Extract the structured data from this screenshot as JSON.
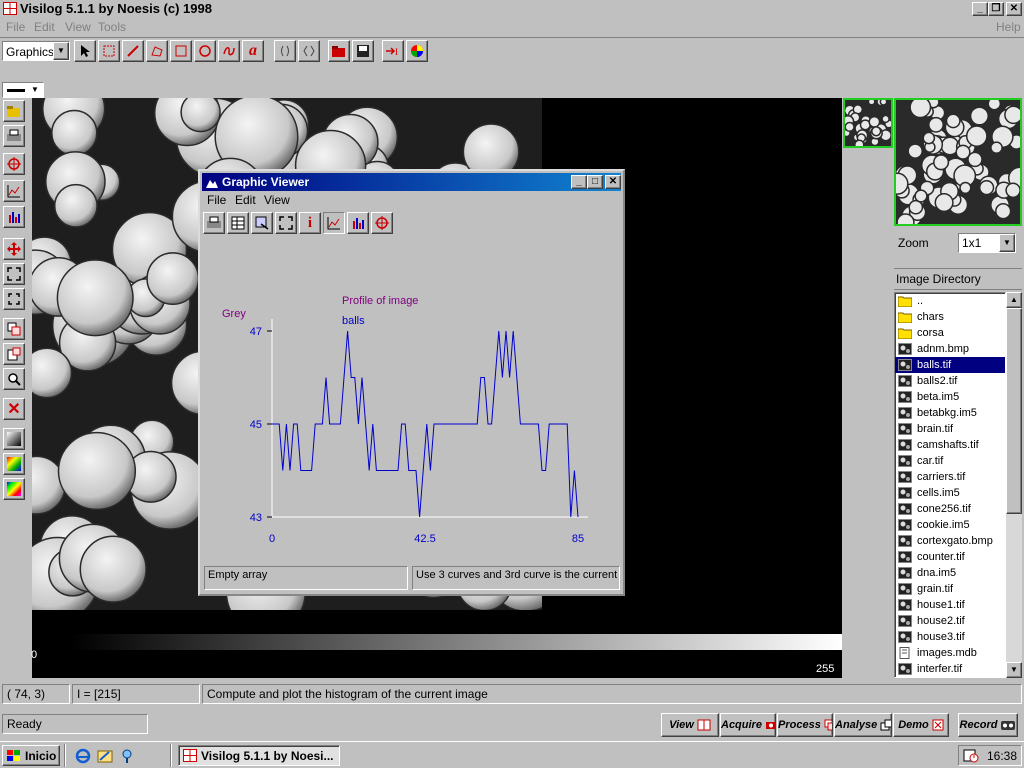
{
  "app": {
    "title": "Visilog 5.1.1 by Noesis (c) 1998"
  },
  "menu": {
    "items": [
      "File",
      "Edit",
      "View",
      "Tools"
    ],
    "help": "Help"
  },
  "toolbar": {
    "mode_select": "Graphics",
    "text_tool": "a"
  },
  "viewer": {
    "title": "Graphic Viewer",
    "menu": [
      "File",
      "Edit",
      "View"
    ],
    "info_icon": "i",
    "status_left": "Empty array",
    "status_right": "Use 3 curves and 3rd curve is the current"
  },
  "chart_data": {
    "type": "line",
    "title": "Profile of image",
    "series": [
      {
        "name": "balls",
        "x": [
          0,
          1,
          2,
          3,
          4,
          5,
          6,
          7,
          8,
          9,
          10,
          11,
          12,
          13,
          14,
          15,
          16,
          17,
          18,
          19,
          20,
          21,
          22,
          23,
          24,
          25,
          26,
          27,
          28,
          29,
          30,
          31,
          32,
          33,
          34,
          35,
          36,
          37,
          38,
          39,
          40,
          41,
          42,
          43,
          44,
          45,
          46,
          47,
          48,
          49,
          50,
          51,
          52,
          53,
          54,
          55,
          56,
          57,
          58,
          59,
          60,
          61,
          62,
          63,
          64,
          65,
          66,
          67,
          68,
          69,
          70,
          71,
          72,
          73,
          74,
          75,
          76,
          77,
          78,
          79,
          80,
          81,
          82,
          83,
          84,
          85
        ],
        "values": [
          45,
          45,
          45,
          44,
          45,
          44,
          45,
          45,
          44,
          44,
          44,
          44,
          45,
          45,
          45,
          46,
          45,
          45,
          45,
          45,
          46,
          47,
          46,
          46,
          45,
          46,
          45,
          44,
          45,
          44,
          44,
          44,
          44,
          44,
          44,
          44,
          45,
          45,
          44,
          44,
          44,
          43,
          44,
          45,
          44,
          45,
          45,
          45,
          45,
          45,
          45,
          45,
          45,
          45,
          45,
          45,
          45,
          45,
          46,
          46,
          45,
          45,
          46,
          47,
          46,
          47,
          46,
          47,
          46,
          45,
          45,
          45,
          45,
          45,
          45,
          44,
          44,
          45,
          45,
          45,
          45,
          45,
          45,
          43,
          44,
          43
        ]
      }
    ],
    "ylabel": "Grey",
    "ylim": [
      43,
      47
    ],
    "yticks": [
      "43",
      "45",
      "47"
    ],
    "xlim": [
      0,
      85
    ],
    "xticks": [
      "0",
      "42.5",
      "85"
    ]
  },
  "panel": {
    "zoom_label": "Zoom",
    "zoom_value": "1x1",
    "directory_label": "Image Directory",
    "files": [
      {
        "name": "..",
        "type": "folder"
      },
      {
        "name": "chars",
        "type": "folder"
      },
      {
        "name": "corsa",
        "type": "folder"
      },
      {
        "name": "adnm.bmp",
        "type": "image"
      },
      {
        "name": "balls.tif",
        "type": "image",
        "selected": true
      },
      {
        "name": "balls2.tif",
        "type": "image"
      },
      {
        "name": "beta.im5",
        "type": "image"
      },
      {
        "name": "betabkg.im5",
        "type": "image"
      },
      {
        "name": "brain.tif",
        "type": "image"
      },
      {
        "name": "camshafts.tif",
        "type": "image"
      },
      {
        "name": "car.tif",
        "type": "image"
      },
      {
        "name": "carriers.tif",
        "type": "image"
      },
      {
        "name": "cells.im5",
        "type": "image"
      },
      {
        "name": "cone256.tif",
        "type": "image"
      },
      {
        "name": "cookie.im5",
        "type": "image"
      },
      {
        "name": "cortexgato.bmp",
        "type": "image"
      },
      {
        "name": "counter.tif",
        "type": "image"
      },
      {
        "name": "dna.im5",
        "type": "image"
      },
      {
        "name": "grain.tif",
        "type": "image"
      },
      {
        "name": "house1.tif",
        "type": "image"
      },
      {
        "name": "house2.tif",
        "type": "image"
      },
      {
        "name": "house3.tif",
        "type": "image"
      },
      {
        "name": "images.mdb",
        "type": "doc"
      },
      {
        "name": "interfer.tif",
        "type": "image"
      }
    ]
  },
  "greyscale": {
    "min": "0",
    "max": "255"
  },
  "status": {
    "coords": "( 74,   3)",
    "intensity": "I = [215]",
    "message": "Compute and plot the histogram of the current image",
    "ready": "Ready"
  },
  "bottom_buttons": [
    "View",
    "Acquire",
    "Process",
    "Analyse",
    "Demo",
    "Record"
  ],
  "taskbar": {
    "start": "Inicio",
    "task": "Visilog 5.1.1 by Noesi...",
    "clock": "16:38"
  },
  "colors": {
    "chart_line": "#0000cc",
    "title_text": "#800080",
    "selection": "#000080",
    "titlebar_start": "#000080",
    "titlebar_end": "#1084d0"
  }
}
